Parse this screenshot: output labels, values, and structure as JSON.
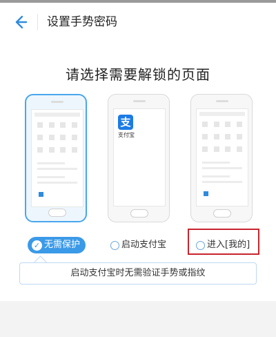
{
  "header": {
    "title": "设置手势密码",
    "back_icon": "back-arrow-icon",
    "accent": "#2f8bde"
  },
  "main": {
    "headline": "请选择需要解锁的页面",
    "options": [
      {
        "label": "无需保护",
        "selected": true
      },
      {
        "label": "启动支付宝",
        "selected": false
      },
      {
        "label": "进入[我的]",
        "selected": false
      }
    ],
    "alipay": {
      "logo_char": "支",
      "name": "支付宝"
    },
    "tip": "启动支付宝时无需验证手势或指纹"
  },
  "colors": {
    "selected": "#3b9ae8",
    "highlight_box": "#c8232b"
  }
}
